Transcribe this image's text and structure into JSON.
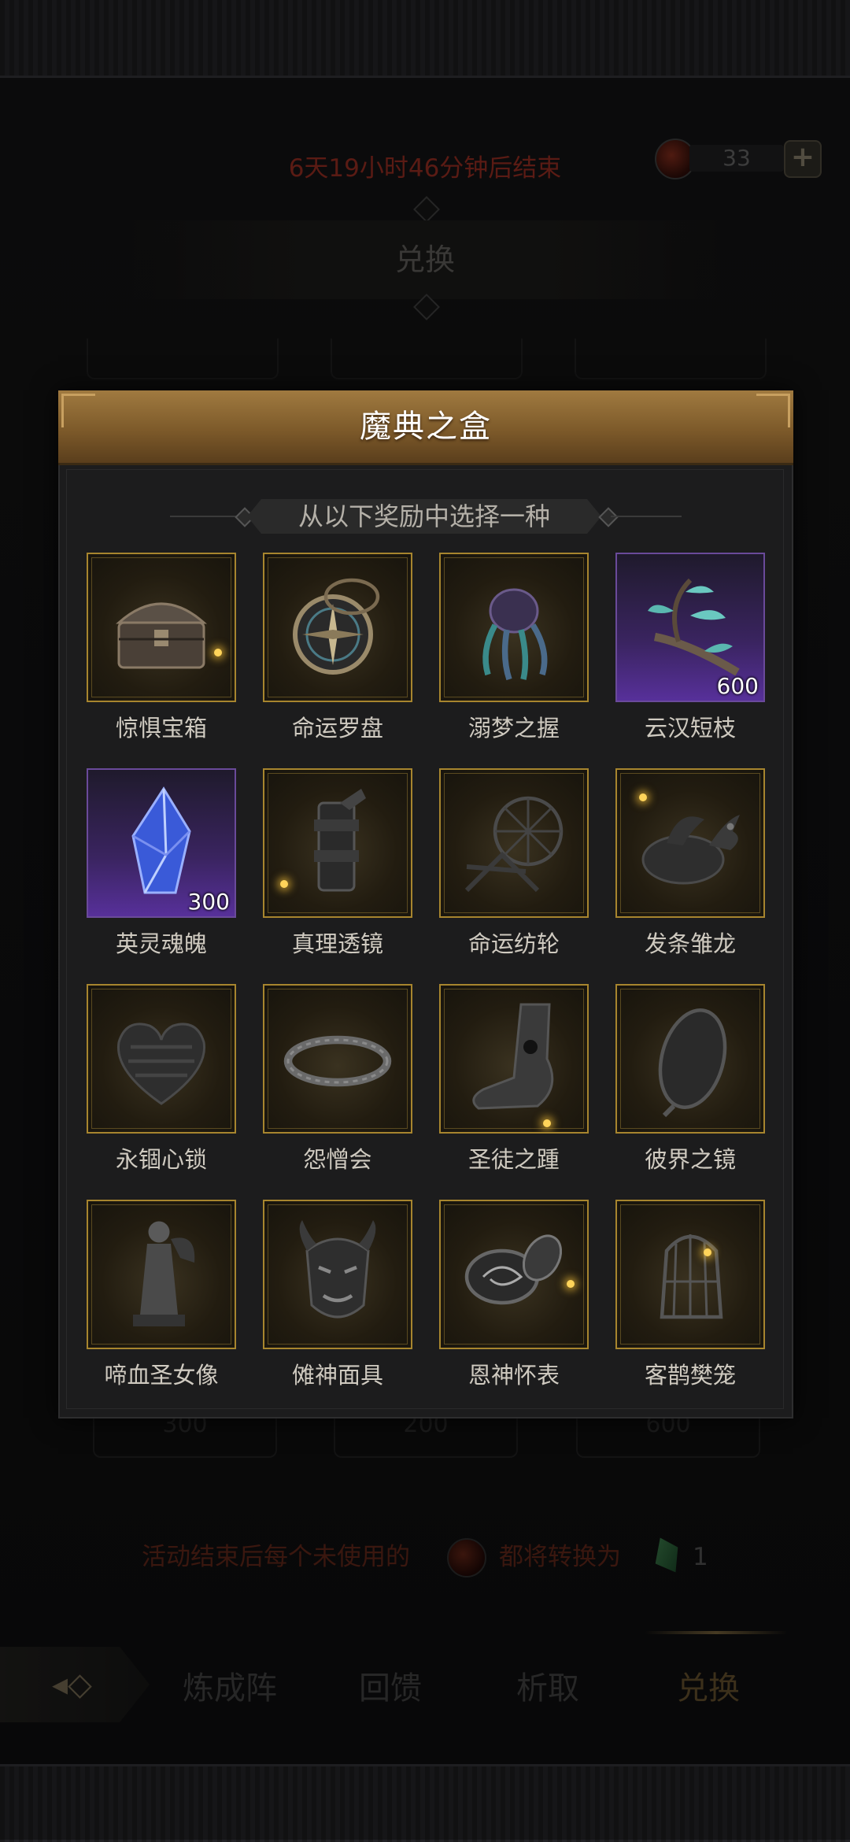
{
  "event": {
    "timer_text": "6天19小时46分钟后结束",
    "currency_count": "33",
    "currency_add_label": "+",
    "section_title": "兑换"
  },
  "background_costs": [
    "300",
    "200",
    "600"
  ],
  "notice": {
    "prefix": "活动结束后每个未使用的",
    "middle": "都将转换为",
    "amount": "1"
  },
  "bottom_nav": {
    "items": [
      {
        "label": "炼成阵"
      },
      {
        "label": "回馈"
      },
      {
        "label": "析取"
      },
      {
        "label": "兑换"
      }
    ],
    "active": "兑换"
  },
  "modal": {
    "title": "魔典之盒",
    "subtitle": "从以下奖励中选择一种",
    "items": [
      {
        "name": "惊惧宝箱",
        "icon": "treasure-chest-icon",
        "rarity": "gold"
      },
      {
        "name": "命运罗盘",
        "icon": "compass-icon",
        "rarity": "gold"
      },
      {
        "name": "溺梦之握",
        "icon": "tentacle-claw-icon",
        "rarity": "gold"
      },
      {
        "name": "云汉短枝",
        "icon": "branch-icon",
        "rarity": "purple",
        "quantity": "600"
      },
      {
        "name": "英灵魂魄",
        "icon": "crystal-icon",
        "rarity": "purple",
        "quantity": "300"
      },
      {
        "name": "真理透镜",
        "icon": "lens-icon",
        "rarity": "gold"
      },
      {
        "name": "命运纺轮",
        "icon": "spinning-wheel-icon",
        "rarity": "gold"
      },
      {
        "name": "发条雏龙",
        "icon": "clockwork-dragon-icon",
        "rarity": "gold"
      },
      {
        "name": "永锢心锁",
        "icon": "heart-lock-icon",
        "rarity": "gold"
      },
      {
        "name": "怨憎会",
        "icon": "thorn-ring-icon",
        "rarity": "gold"
      },
      {
        "name": "圣徒之踵",
        "icon": "saint-foot-icon",
        "rarity": "gold"
      },
      {
        "name": "彼界之镜",
        "icon": "mirror-icon",
        "rarity": "gold"
      },
      {
        "name": "啼血圣女像",
        "icon": "statue-icon",
        "rarity": "gold"
      },
      {
        "name": "傩神面具",
        "icon": "oni-mask-icon",
        "rarity": "gold"
      },
      {
        "name": "恩神怀表",
        "icon": "pocket-watch-icon",
        "rarity": "gold"
      },
      {
        "name": "客鹊樊笼",
        "icon": "birdcage-icon",
        "rarity": "gold"
      }
    ]
  },
  "colors": {
    "header_gold": "#a07a40",
    "item_border_gold": "#a7852e",
    "item_border_purple": "#6a4a9a",
    "timer_red": "#8a2a20"
  }
}
